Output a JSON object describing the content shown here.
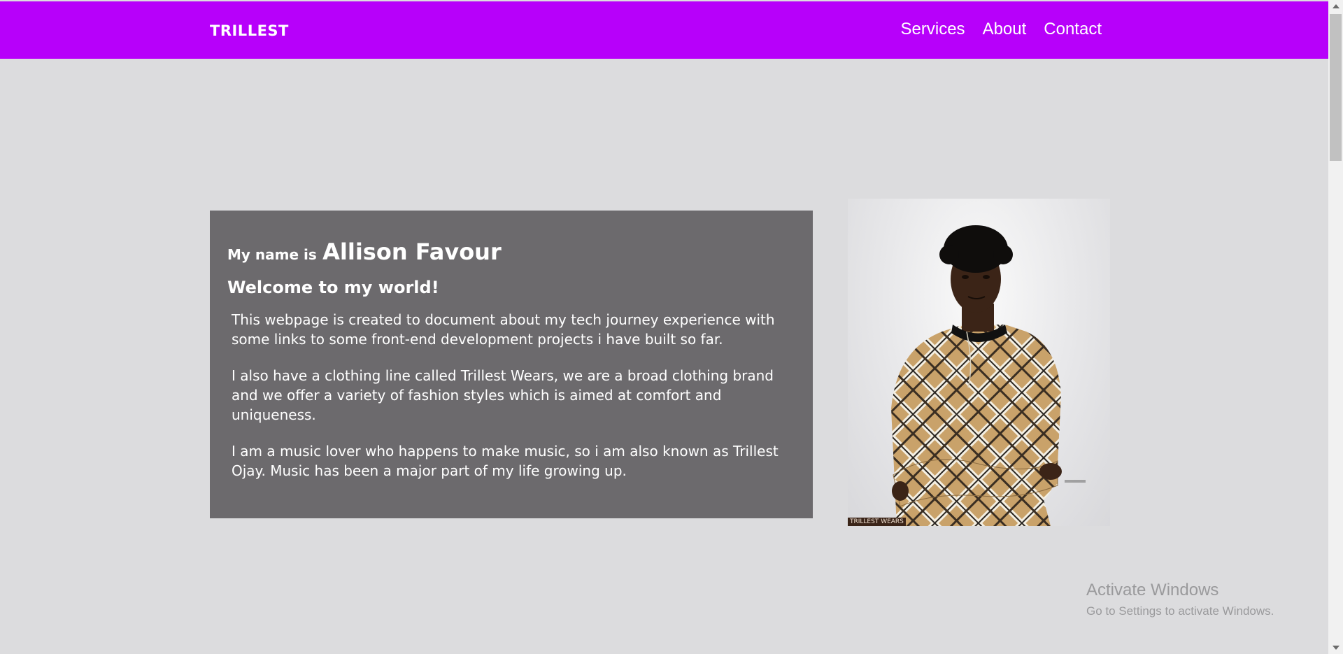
{
  "nav": {
    "brand": "TRILLEST",
    "links": [
      "Services",
      "About",
      "Contact"
    ]
  },
  "intro": {
    "prefix": "My name is",
    "name": "Allison Favour",
    "welcome": "Welcome to my world!",
    "paragraphs": [
      "This webpage is created to document about my tech journey experience with some links to some front-end development projects i have built so far.",
      "I also have a clothing line called Trillest Wears, we are a broad clothing brand and we offer a variety of fashion styles which is aimed at comfort and uniqueness.",
      "I am a music lover who happens to make music, so i am also known as Trillest Ojay. Music has been a major part of my life growing up."
    ]
  },
  "photo": {
    "tag": "TRILLEST WEARS"
  },
  "windows_watermark": {
    "title": "Activate Windows",
    "subtitle": "Go to Settings to activate Windows."
  },
  "colors": {
    "navbar": "#b700fa",
    "background": "#dcdcde",
    "card": "#6c6a6d"
  }
}
